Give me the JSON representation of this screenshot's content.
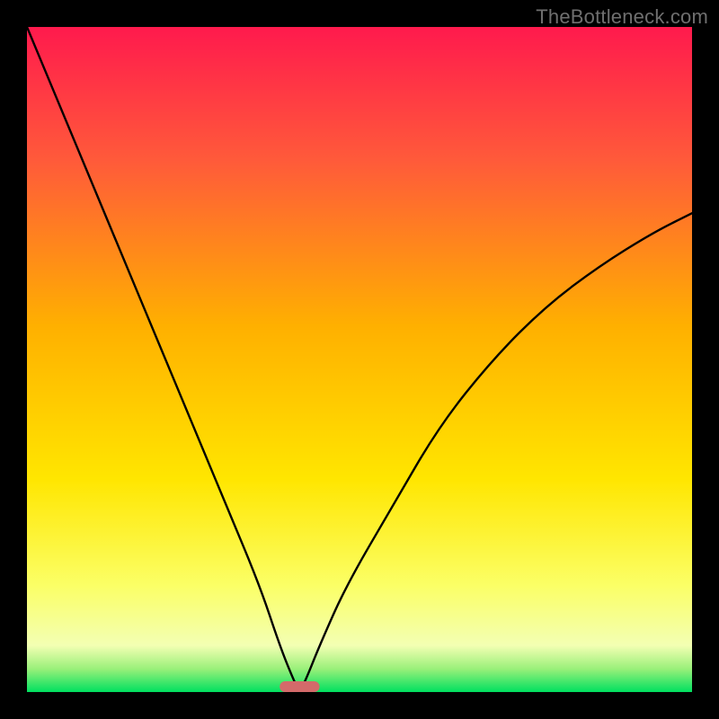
{
  "watermark": "TheBottleneck.com",
  "chart_data": {
    "type": "line",
    "title": "",
    "xlabel": "",
    "ylabel": "",
    "xlim": [
      0,
      100
    ],
    "ylim": [
      0,
      100
    ],
    "grid": false,
    "legend": false,
    "annotations": [
      {
        "name": "min-marker",
        "x_center": 41,
        "x_width": 6,
        "y": 0,
        "color": "#d46a6a"
      }
    ],
    "series": [
      {
        "name": "bottleneck-curve",
        "color": "#000000",
        "x": [
          0,
          5,
          10,
          15,
          20,
          25,
          30,
          35,
          38,
          40,
          41,
          42,
          44,
          48,
          55,
          62,
          70,
          78,
          86,
          94,
          100
        ],
        "values": [
          100,
          88,
          76,
          64,
          52,
          40,
          28,
          16,
          7,
          2,
          0,
          2,
          7,
          16,
          28,
          40,
          50,
          58,
          64,
          69,
          72
        ]
      }
    ],
    "background_gradient": {
      "direction": "vertical",
      "stops": [
        {
          "offset": 0.0,
          "color": "#ff1a4d"
        },
        {
          "offset": 0.2,
          "color": "#ff5a3a"
        },
        {
          "offset": 0.45,
          "color": "#ffb000"
        },
        {
          "offset": 0.68,
          "color": "#ffe600"
        },
        {
          "offset": 0.84,
          "color": "#fbff66"
        },
        {
          "offset": 0.93,
          "color": "#f3ffb3"
        },
        {
          "offset": 0.965,
          "color": "#9af07a"
        },
        {
          "offset": 1.0,
          "color": "#00e060"
        }
      ]
    }
  }
}
